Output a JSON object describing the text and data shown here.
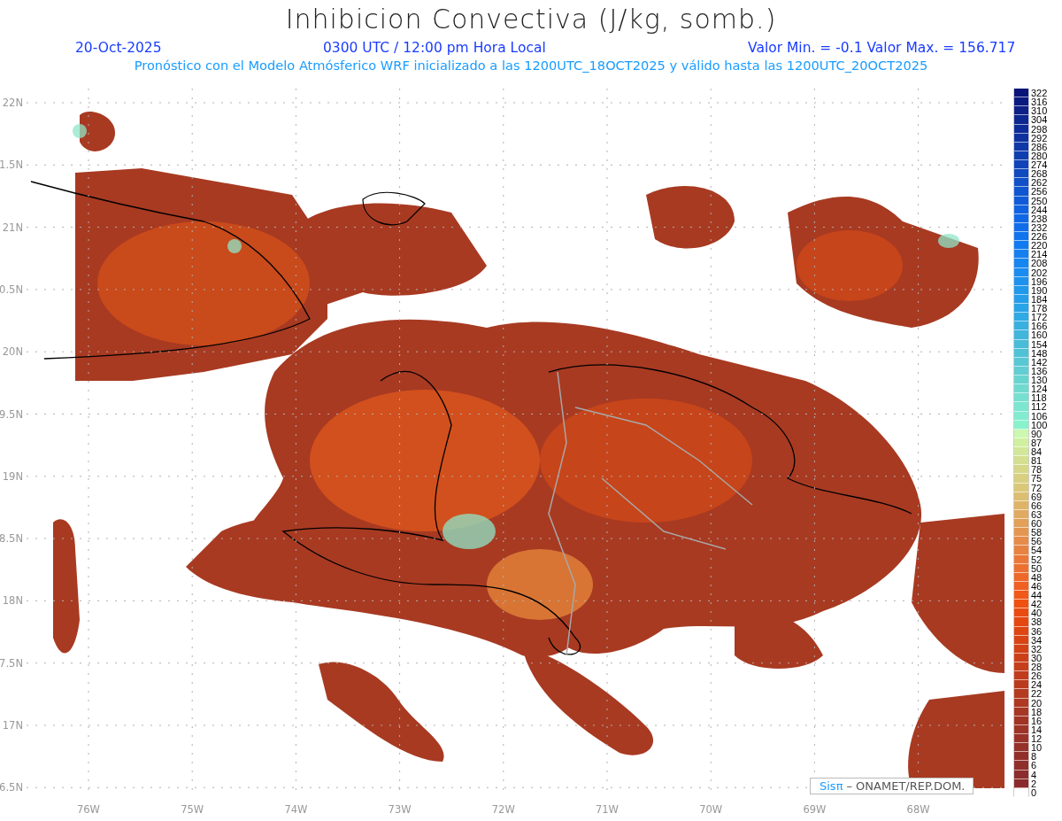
{
  "title": "Inhibicion Convectiva (J/kg, somb.)",
  "info": {
    "date": "20-Oct-2025",
    "time": "0300 UTC / 12:00 pm Hora Local",
    "range": "Valor Min. = -0.1  Valor Max. = 156.717"
  },
  "subtitle": "Pronóstico con el Modelo Atmósferico WRF inicializado a las 1200UTC_18OCT2025 y válido hasta las  1200UTC_20OCT2025",
  "lat_labels": [
    "22N",
    "1.5N",
    "21N",
    "0.5N",
    "20N",
    "9.5N",
    "19N",
    "8.5N",
    "18N",
    "7.5N",
    "17N",
    "6.5N"
  ],
  "lon_labels": [
    "76W",
    "75W",
    "74W",
    "73W",
    "72W",
    "71W",
    "70W",
    "69W",
    "68W"
  ],
  "credit": {
    "brand": "Sisπ",
    "text": "– ONAMET/REP.DOM."
  },
  "colorbar": [
    {
      "label": "322",
      "color": "#0a1478"
    },
    {
      "label": "316",
      "color": "#0b1a80"
    },
    {
      "label": "310",
      "color": "#0c2088"
    },
    {
      "label": "304",
      "color": "#0d2690"
    },
    {
      "label": "298",
      "color": "#0e2c98"
    },
    {
      "label": "292",
      "color": "#0f32a0"
    },
    {
      "label": "286",
      "color": "#1038a8"
    },
    {
      "label": "280",
      "color": "#103eb0"
    },
    {
      "label": "274",
      "color": "#1044b8"
    },
    {
      "label": "268",
      "color": "#104ac0"
    },
    {
      "label": "262",
      "color": "#1050c8"
    },
    {
      "label": "256",
      "color": "#1056d0"
    },
    {
      "label": "250",
      "color": "#105cd8"
    },
    {
      "label": "244",
      "color": "#1062e0"
    },
    {
      "label": "238",
      "color": "#1068e6"
    },
    {
      "label": "232",
      "color": "#106eea"
    },
    {
      "label": "226",
      "color": "#1074ee"
    },
    {
      "label": "220",
      "color": "#127af0"
    },
    {
      "label": "214",
      "color": "#1480f0"
    },
    {
      "label": "208",
      "color": "#1686f0"
    },
    {
      "label": "202",
      "color": "#188cf0"
    },
    {
      "label": "196",
      "color": "#1c92ee"
    },
    {
      "label": "190",
      "color": "#2098ec"
    },
    {
      "label": "184",
      "color": "#249eea"
    },
    {
      "label": "178",
      "color": "#28a4e8"
    },
    {
      "label": "172",
      "color": "#30aae4"
    },
    {
      "label": "166",
      "color": "#38b0e0"
    },
    {
      "label": "160",
      "color": "#40b6dc"
    },
    {
      "label": "154",
      "color": "#48bcd8"
    },
    {
      "label": "148",
      "color": "#50c2d6"
    },
    {
      "label": "142",
      "color": "#58c8d4"
    },
    {
      "label": "136",
      "color": "#60ced2"
    },
    {
      "label": "130",
      "color": "#68d4d0"
    },
    {
      "label": "124",
      "color": "#70dad0"
    },
    {
      "label": "118",
      "color": "#76e0d0"
    },
    {
      "label": "112",
      "color": "#7ce6d0"
    },
    {
      "label": "106",
      "color": "#82ecd0"
    },
    {
      "label": "100",
      "color": "#88f2cc"
    },
    {
      "label": "90",
      "color": "#ccf8b0"
    },
    {
      "label": "87",
      "color": "#d0f0a0"
    },
    {
      "label": "84",
      "color": "#d2e898"
    },
    {
      "label": "81",
      "color": "#d4e090"
    },
    {
      "label": "78",
      "color": "#d6d888"
    },
    {
      "label": "75",
      "color": "#d8d080"
    },
    {
      "label": "72",
      "color": "#dac878"
    },
    {
      "label": "69",
      "color": "#dcbe70"
    },
    {
      "label": "66",
      "color": "#deb468"
    },
    {
      "label": "63",
      "color": "#e0aa60"
    },
    {
      "label": "60",
      "color": "#e2a058"
    },
    {
      "label": "58",
      "color": "#e49650"
    },
    {
      "label": "56",
      "color": "#e68c48"
    },
    {
      "label": "54",
      "color": "#e88240"
    },
    {
      "label": "52",
      "color": "#ea7838"
    },
    {
      "label": "50",
      "color": "#ec7030"
    },
    {
      "label": "48",
      "color": "#ee6828"
    },
    {
      "label": "46",
      "color": "#f06020"
    },
    {
      "label": "44",
      "color": "#f25818"
    },
    {
      "label": "42",
      "color": "#f05010"
    },
    {
      "label": "40",
      "color": "#ea4c10"
    },
    {
      "label": "38",
      "color": "#e44810"
    },
    {
      "label": "36",
      "color": "#de4612"
    },
    {
      "label": "34",
      "color": "#d84414"
    },
    {
      "label": "32",
      "color": "#d24216"
    },
    {
      "label": "30",
      "color": "#cc4018"
    },
    {
      "label": "28",
      "color": "#c63e1a"
    },
    {
      "label": "26",
      "color": "#c03c1c"
    },
    {
      "label": "24",
      "color": "#ba3a1e"
    },
    {
      "label": "22",
      "color": "#b43a20"
    },
    {
      "label": "20",
      "color": "#ae3822"
    },
    {
      "label": "18",
      "color": "#a83624"
    },
    {
      "label": "16",
      "color": "#a23426"
    },
    {
      "label": "14",
      "color": "#9e3428"
    },
    {
      "label": "12",
      "color": "#9a322a"
    },
    {
      "label": "10",
      "color": "#96302a"
    },
    {
      "label": "8",
      "color": "#922e2a"
    },
    {
      "label": "6",
      "color": "#902e2c"
    },
    {
      "label": "4",
      "color": "#8c2c2c"
    },
    {
      "label": "2",
      "color": "#8a2a2c"
    },
    {
      "label": "0",
      "color": "#ffffff"
    }
  ]
}
